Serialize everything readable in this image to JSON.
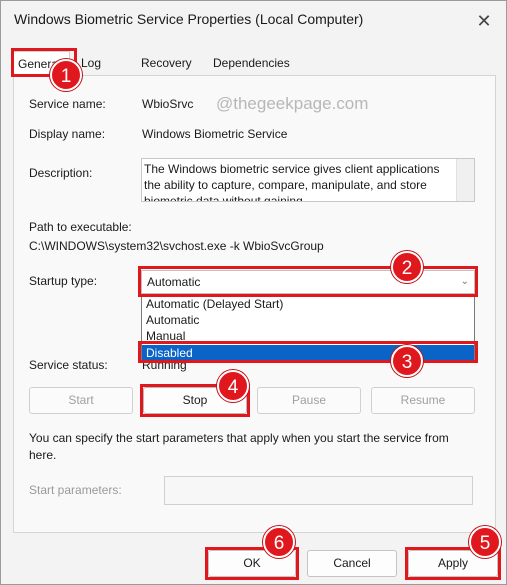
{
  "window": {
    "title": "Windows Biometric Service Properties (Local Computer)",
    "close_glyph": "✕"
  },
  "tabs": [
    {
      "label": "General"
    },
    {
      "label": "Log On"
    },
    {
      "label": "Recovery"
    },
    {
      "label": "Dependencies"
    }
  ],
  "watermark": "@thegeekpage.com",
  "fields": {
    "service_name_label": "Service name:",
    "service_name_value": "WbioSrvc",
    "display_name_label": "Display name:",
    "display_name_value": "Windows Biometric Service",
    "description_label": "Description:",
    "description_value": "The Windows biometric service gives client applications the ability to capture, compare, manipulate, and store biometric data without gaining",
    "path_label": "Path to executable:",
    "path_value": "C:\\WINDOWS\\system32\\svchost.exe -k WbioSvcGroup",
    "startup_type_label": "Startup type:",
    "startup_type_value": "Automatic",
    "service_status_label": "Service status:",
    "service_status_value": "Running"
  },
  "startup_options": [
    "Automatic (Delayed Start)",
    "Automatic",
    "Manual",
    "Disabled"
  ],
  "service_buttons": {
    "start": "Start",
    "stop": "Stop",
    "pause": "Pause",
    "resume": "Resume"
  },
  "start_params": {
    "info": "You can specify the start parameters that apply when you start the service from here.",
    "label": "Start parameters:",
    "value": ""
  },
  "dialog_buttons": {
    "ok": "OK",
    "cancel": "Cancel",
    "apply": "Apply"
  },
  "annotations": {
    "b1": "1",
    "b2": "2",
    "b3": "3",
    "b4": "4",
    "b5": "5",
    "b6": "6"
  },
  "colors": {
    "highlight_red": "#e0181d",
    "selection_blue": "#0a64c8"
  }
}
